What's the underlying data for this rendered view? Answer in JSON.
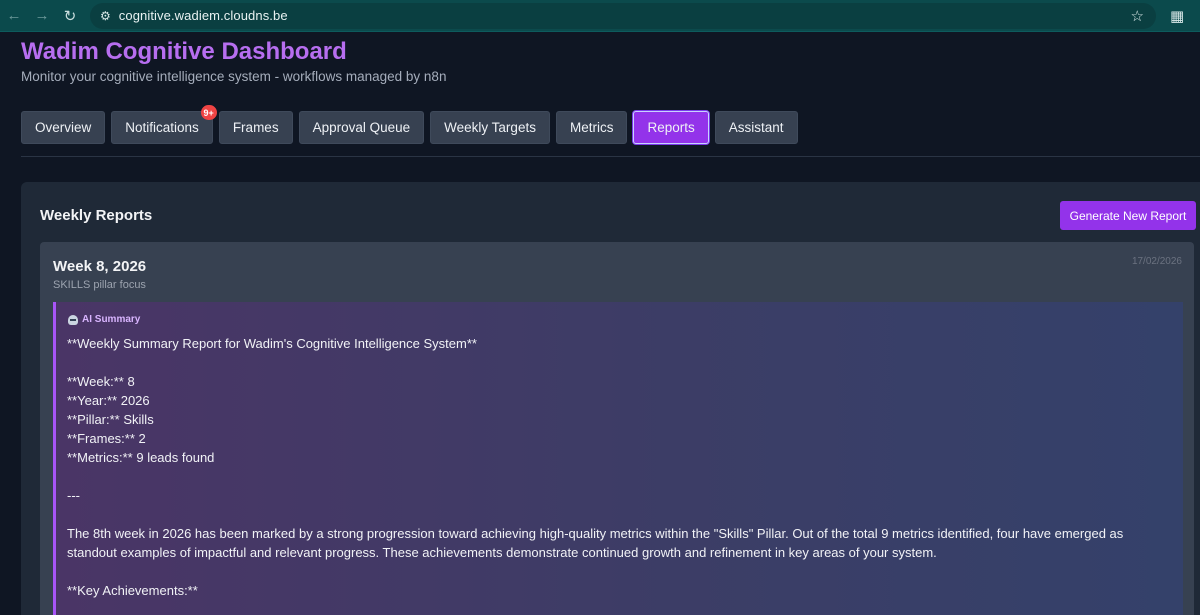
{
  "browser": {
    "url": "cognitive.wadiem.cloudns.be"
  },
  "header": {
    "title": "Wadim Cognitive Dashboard",
    "subtitle": "Monitor your cognitive intelligence system - workflows managed by n8n"
  },
  "tabs": [
    {
      "label": "Overview"
    },
    {
      "label": "Notifications",
      "badge": "9+"
    },
    {
      "label": "Frames"
    },
    {
      "label": "Approval Queue"
    },
    {
      "label": "Weekly Targets"
    },
    {
      "label": "Metrics"
    },
    {
      "label": "Reports",
      "active": true
    },
    {
      "label": "Assistant"
    }
  ],
  "reports": {
    "title": "Weekly Reports",
    "generate_label": "Generate New Report",
    "items": [
      {
        "week": "Week 8, 2026",
        "date": "17/02/2026",
        "focus": "SKILLS pillar focus",
        "summary_label": "AI Summary",
        "summary_lines": [
          "**Weekly Summary Report for Wadim's Cognitive Intelligence System**",
          "",
          "**Week:** 8",
          "**Year:** 2026",
          "**Pillar:** Skills",
          "**Frames:** 2",
          "**Metrics:** 9 leads found",
          "",
          "---",
          "",
          "The 8th week in 2026 has been marked by a strong progression toward achieving high-quality metrics within the \"Skills\" Pillar. Out of the total 9 metrics identified, four have emerged as standout examples of impactful and relevant progress. These achievements demonstrate continued growth and refinement in key areas of your system.",
          "",
          "**Key Achievements:**"
        ]
      }
    ]
  },
  "colors": {
    "accent": "#9333ea",
    "title": "#b76ef0",
    "badge": "#ef4444"
  },
  "icons": [
    "back-arrow-icon",
    "forward-arrow-icon",
    "reload-icon",
    "site-settings-icon",
    "bookmark-star-icon",
    "extensions-icon",
    "robot-icon"
  ]
}
